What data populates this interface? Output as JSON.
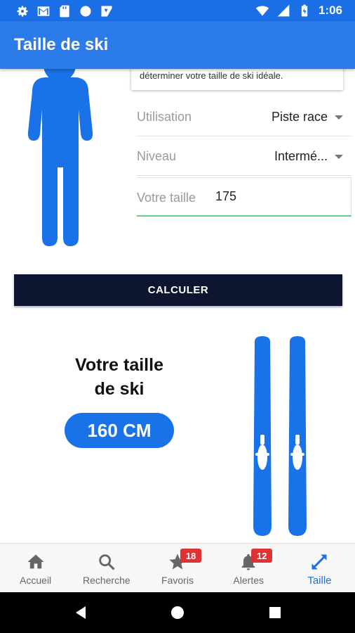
{
  "status_bar": {
    "time": "1:06",
    "left_icons": [
      "settings-icon",
      "gmail-icon",
      "sd-card-icon",
      "circle-icon",
      "download-icon"
    ],
    "right_icons": [
      "wifi-icon",
      "signal-icon",
      "battery-icon"
    ]
  },
  "app_bar": {
    "title": "Taille de ski"
  },
  "info_card": {
    "text": "déterminer votre taille de ski idéale."
  },
  "form": {
    "usage_label": "Utilisation",
    "usage_value": "Piste race",
    "level_label": "Niveau",
    "level_value": "Intermé...",
    "height_label": "Votre taille",
    "height_value": "175"
  },
  "calc_button": {
    "label": "CALCULER"
  },
  "result": {
    "title_line1": "Votre taille",
    "title_line2": "de ski",
    "value": "160 CM"
  },
  "bottom_nav": {
    "items": [
      {
        "label": "Accueil",
        "icon": "home-icon"
      },
      {
        "label": "Recherche",
        "icon": "search-icon"
      },
      {
        "label": "Favoris",
        "icon": "star-icon",
        "badge": "18"
      },
      {
        "label": "Alertes",
        "icon": "bell-icon",
        "badge": "12"
      },
      {
        "label": "Taille",
        "icon": "resize-icon",
        "active": true
      }
    ]
  },
  "colors": {
    "primary": "#2c7bea",
    "status_bar": "#1a6fe6",
    "figure_blue": "#1a72e8",
    "button_dark": "#0e1530",
    "badge_red": "#e03232",
    "input_underline": "#5ed27a"
  }
}
